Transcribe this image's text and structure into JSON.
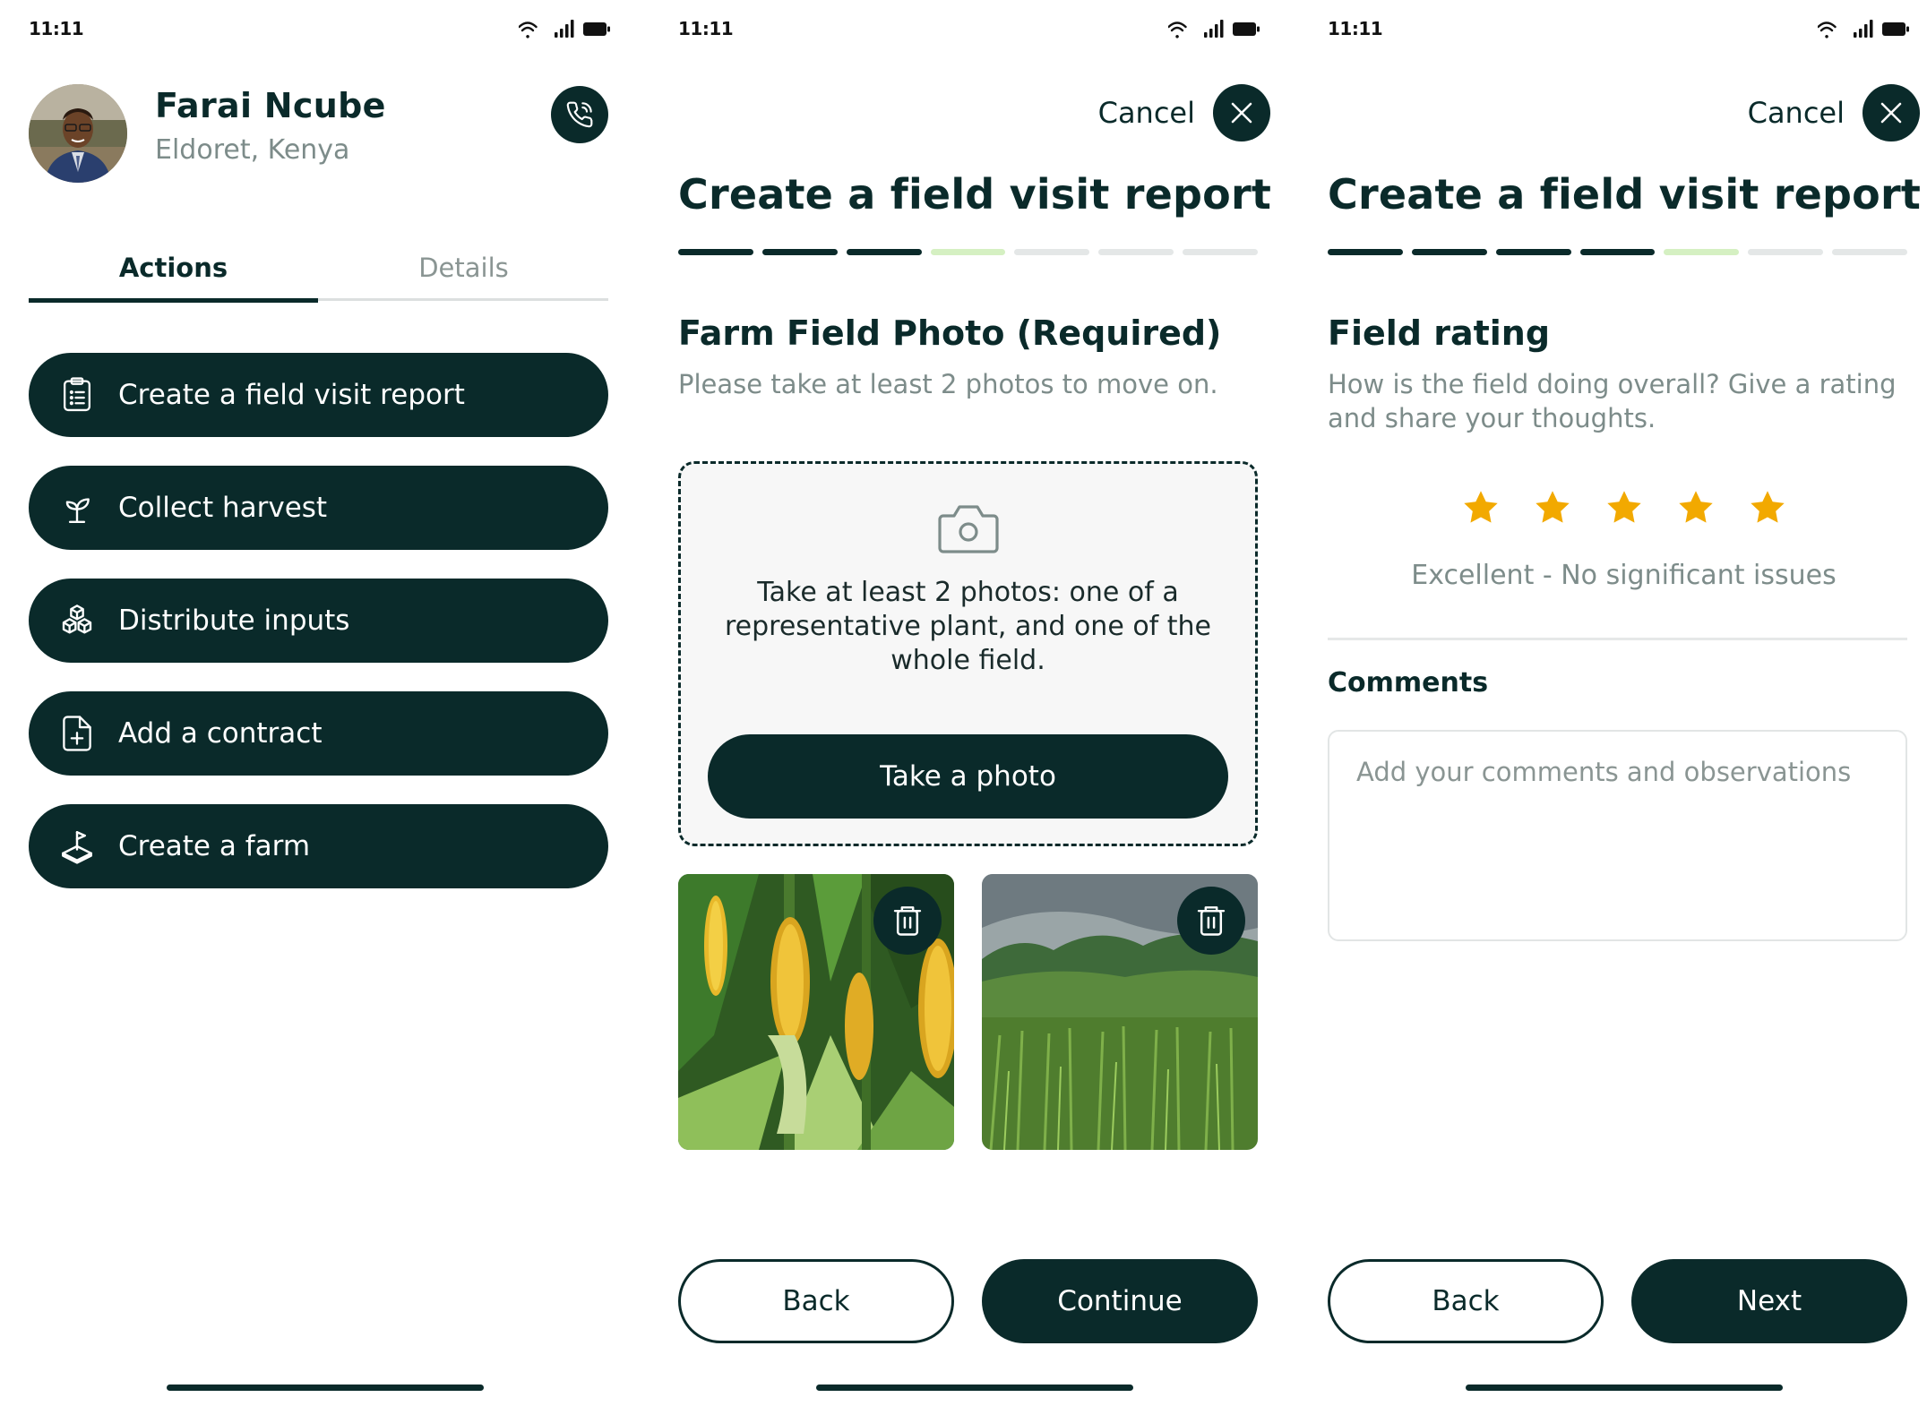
{
  "status_bar": {
    "time": "11:11"
  },
  "profile": {
    "name": "Farai Ncube",
    "location": "Eldoret, Kenya",
    "tabs": [
      "Actions",
      "Details"
    ],
    "actions": [
      {
        "label": "Create a field visit report",
        "icon": "clipboard-icon"
      },
      {
        "label": "Collect harvest",
        "icon": "sprout-icon"
      },
      {
        "label": "Distribute inputs",
        "icon": "boxes-icon"
      },
      {
        "label": "Add a contract",
        "icon": "document-plus-icon"
      },
      {
        "label": "Create a farm",
        "icon": "farm-plot-icon"
      }
    ]
  },
  "photo_step": {
    "cancel_label": "Cancel",
    "title": "Create a field visit report",
    "progress": {
      "total": 7,
      "completed": 3,
      "current": 4
    },
    "section_title": "Farm Field Photo (Required)",
    "section_subtitle": "Please take at least 2 photos to move on.",
    "instructions": "Take at least 2 photos: one of a representative plant, and one of the whole field.",
    "take_photo_label": "Take a photo",
    "back_label": "Back",
    "continue_label": "Continue"
  },
  "rating_step": {
    "cancel_label": "Cancel",
    "title": "Create a field visit report",
    "progress": {
      "total": 7,
      "completed": 4,
      "current": 5
    },
    "section_title": "Field rating",
    "section_subtitle": "How is the field doing overall? Give a rating and share your thoughts.",
    "rating": {
      "value": 5,
      "max": 5,
      "label": "Excellent - No significant issues"
    },
    "comments_label": "Comments",
    "comments_placeholder": "Add your comments and observations",
    "comments_value": "",
    "back_label": "Back",
    "next_label": "Next"
  },
  "colors": {
    "primary": "#0a2a2a",
    "progress_done": "#0a2a2a",
    "progress_current": "#d5f0c2",
    "progress_pending": "#e4e7e7",
    "star": "#f2a900",
    "muted_text": "#7d8c8a"
  }
}
